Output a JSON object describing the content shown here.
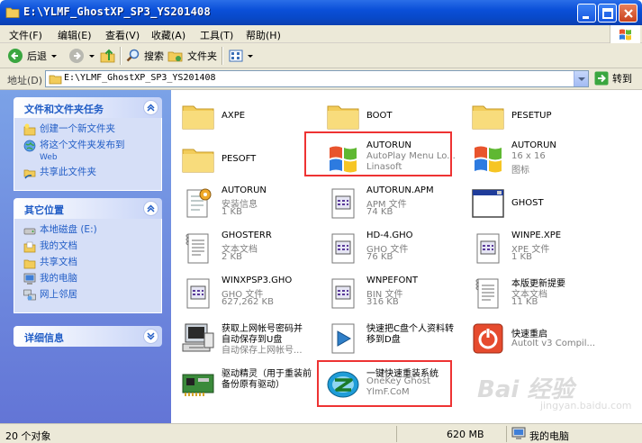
{
  "window": {
    "title": "E:\\YLMF_GhostXP_SP3_YS201408"
  },
  "menu": [
    "文件(F)",
    "编辑(E)",
    "查看(V)",
    "收藏(A)",
    "工具(T)",
    "帮助(H)"
  ],
  "toolbar": {
    "back": "后退",
    "search": "搜索",
    "folders": "文件夹"
  },
  "address": {
    "label": "地址(D)",
    "value": "E:\\YLMF_GhostXP_SP3_YS201408",
    "go": "转到"
  },
  "tasks": {
    "title": "文件和文件夹任务",
    "items": [
      "创建一个新文件夹",
      "将这个文件夹发布到",
      "Web",
      "共享此文件夹"
    ]
  },
  "places": {
    "title": "其它位置",
    "items": [
      "本地磁盘 (E:)",
      "我的文档",
      "共享文档",
      "我的电脑",
      "网上邻居"
    ]
  },
  "details": {
    "title": "详细信息"
  },
  "files": [
    {
      "name": "AXPE",
      "type": "folder"
    },
    {
      "name": "BOOT",
      "type": "folder"
    },
    {
      "name": "PESETUP",
      "type": "folder"
    },
    {
      "name": "PESOFT",
      "type": "folder"
    },
    {
      "name": "AUTORUN",
      "sub1": "AutoPlay Menu Lo...",
      "sub2": "Linasoft",
      "type": "windows"
    },
    {
      "name": "AUTORUN",
      "sub1": "16 x 16",
      "sub2": "图标",
      "type": "windows"
    },
    {
      "name": "AUTORUN",
      "sub1": "安装信息",
      "sub2": "1 KB",
      "type": "inf"
    },
    {
      "name": "AUTORUN.APM",
      "sub1": "APM 文件",
      "sub2": "74 KB",
      "type": "doc"
    },
    {
      "name": "GHOST",
      "type": "window"
    },
    {
      "name": "GHOSTERR",
      "sub1": "文本文档",
      "sub2": "2 KB",
      "type": "text"
    },
    {
      "name": "HD-4.GHO",
      "sub1": "GHO 文件",
      "sub2": "76 KB",
      "type": "doc"
    },
    {
      "name": "WINPE.XPE",
      "sub1": "XPE 文件",
      "sub2": "1 KB",
      "type": "doc"
    },
    {
      "name": "WINXPSP3.GHO",
      "sub1": "GHO 文件",
      "sub2": "627,262 KB",
      "type": "doc"
    },
    {
      "name": "WNPEFONT",
      "sub1": "BIN 文件",
      "sub2": "316 KB",
      "type": "doc"
    },
    {
      "name": "本版更新提要",
      "sub1": "文本文档",
      "sub2": "11 KB",
      "type": "text"
    },
    {
      "name": "获取上网帐号密码并",
      "sub1": "自动保存到U盘",
      "sub2": "自动保存上网帐号...",
      "type": "computer"
    },
    {
      "name": "快速把C盘个人资料转",
      "sub1": "移到D盘",
      "sub2": "",
      "type": "arrow"
    },
    {
      "name": "快速重启",
      "sub1": "AutoIt v3 Compil...",
      "sub2": "",
      "type": "power"
    },
    {
      "name": "驱动精灵（用于重装前",
      "sub1": "备份原有驱动）",
      "sub2": "",
      "type": "card"
    },
    {
      "name": "一键快速重装系统",
      "sub1": "OneKey Ghost",
      "sub2": "YlmF.CoM",
      "type": "onekey"
    }
  ],
  "status": {
    "count": "20 个对象",
    "size": "620 MB",
    "location": "我的电脑"
  },
  "watermark": {
    "line1": "Bai 经验",
    "line2": "jingyan.baidu.com"
  }
}
